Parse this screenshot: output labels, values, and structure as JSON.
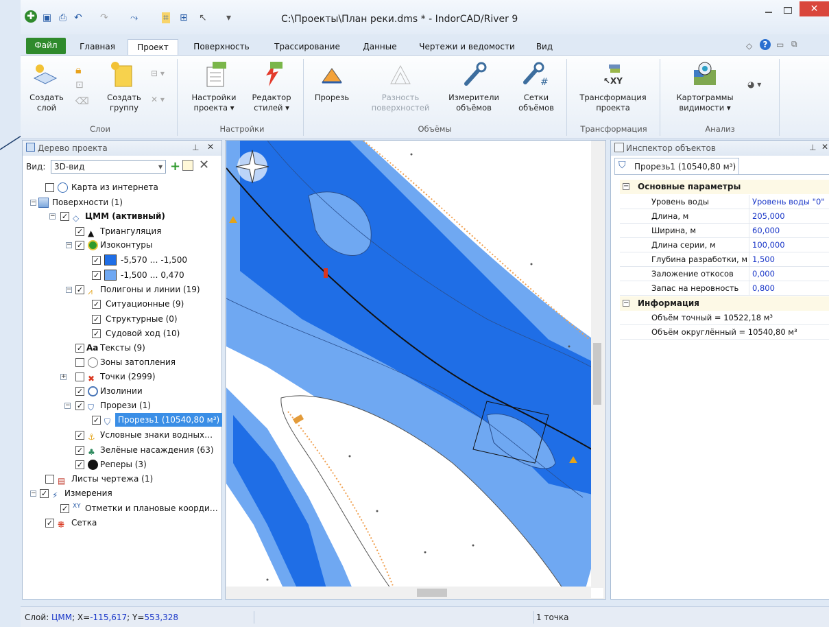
{
  "window": {
    "title": "C:\\Проекты\\План реки.dms * - IndorCAD/River 9"
  },
  "tabs": [
    "Файл",
    "Главная",
    "Проект",
    "Поверхность",
    "Трассирование",
    "Данные",
    "Чертежи и ведомости",
    "Вид"
  ],
  "active_tab": "Проект",
  "ribbon": {
    "create_layer": "Создать\nслой",
    "create_group": "Создать\nгруппу",
    "group_layers": "Слои",
    "project_settings": "Настройки\nпроекта ▾",
    "style_editor": "Редактор\nстилей ▾",
    "group_settings": "Настройки",
    "cut": "Прорезь",
    "surface_diff": "Разность\nповерхностей",
    "volume_meters": "Измерители\nобъёмов",
    "volume_grids": "Сетки\nобъёмов",
    "group_volumes": "Объёмы",
    "project_transform": "Трансформация\nпроекта",
    "group_transform": "Трансформация",
    "visibility_maps": "Картограммы\nвидимости ▾",
    "group_analysis": "Анализ"
  },
  "tree_panel": {
    "title": "Дерево проекта",
    "view_label": "Вид:",
    "view_value": "3D-вид",
    "items": [
      {
        "label": "Карта из интернета",
        "checked": false
      },
      {
        "label": "Поверхности (1)"
      },
      {
        "label": "ЦММ (активный)",
        "checked": true
      },
      {
        "label": "Триангуляция",
        "checked": true
      },
      {
        "label": "Изоконтуры",
        "checked": true
      },
      {
        "label": "-5,570 … -1,500",
        "checked": true,
        "color": "#1f6ee6"
      },
      {
        "label": "-1,500 … 0,470",
        "checked": true,
        "color": "#6fa8f2"
      },
      {
        "label": "Полигоны и линии (19)",
        "checked": true
      },
      {
        "label": "Ситуационные (9)",
        "checked": true
      },
      {
        "label": "Структурные (0)",
        "checked": true
      },
      {
        "label": "Судовой ход (10)",
        "checked": true
      },
      {
        "label": "Тексты (9)",
        "checked": true
      },
      {
        "label": "Зоны затопления",
        "checked": false
      },
      {
        "label": "Точки (2999)",
        "checked": false
      },
      {
        "label": "Изолинии",
        "checked": true
      },
      {
        "label": "Прорези (1)",
        "checked": true
      },
      {
        "label": "Прорезь1 (10540,80 м³)",
        "checked": true,
        "selected": true
      },
      {
        "label": "Условные знаки водных…",
        "checked": true
      },
      {
        "label": "Зелёные насаждения (63)",
        "checked": true
      },
      {
        "label": "Реперы (3)",
        "checked": true
      },
      {
        "label": "Листы чертежа (1)",
        "checked": false
      },
      {
        "label": "Измерения",
        "checked": true
      },
      {
        "label": "Отметки и плановые коорди…",
        "checked": true
      },
      {
        "label": "Сетка",
        "checked": true
      }
    ]
  },
  "inspector": {
    "title": "Инспектор объектов",
    "tab": "Прорезь1 (10540,80 м³)",
    "section_main": "Основные параметры",
    "props": [
      {
        "key": "Уровень воды",
        "value": "Уровень воды \"0\""
      },
      {
        "key": "Длина, м",
        "value": "205,000"
      },
      {
        "key": "Ширина, м",
        "value": "60,000"
      },
      {
        "key": "Длина серии, м",
        "value": "100,000"
      },
      {
        "key": "Глубина разработки, м",
        "value": "1,500"
      },
      {
        "key": "Заложение откосов",
        "value": "0,000"
      },
      {
        "key": "Запас на неровность",
        "value": "0,800"
      }
    ],
    "section_info": "Информация",
    "info": [
      "Объём точный = 10522,18 м³",
      "Объём округлённый = 10540,80 м³"
    ]
  },
  "status": {
    "layer_prefix": "Слой: ",
    "layer": "ЦММ",
    "coords_x_prefix": "; X=",
    "x": "-115,617",
    "coords_y_prefix": "; Y=",
    "y": "553,328",
    "points": "1 точка"
  },
  "colors": {
    "deep": "#1f6ee6",
    "shallow": "#6fa8f2",
    "accent": "#2f8a2c",
    "selection": "#3a8ee6"
  }
}
